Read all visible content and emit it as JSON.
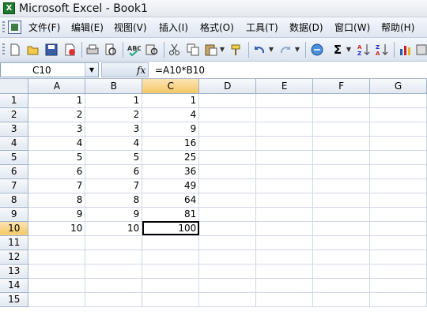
{
  "window": {
    "title": "Microsoft Excel - Book1",
    "app_icon_letter": "X"
  },
  "menu": {
    "items": [
      "文件(F)",
      "编辑(E)",
      "视图(V)",
      "插入(I)",
      "格式(O)",
      "工具(T)",
      "数据(D)",
      "窗口(W)",
      "帮助(H)"
    ]
  },
  "toolbar": {
    "icons": [
      "new-icon",
      "open-icon",
      "save-icon",
      "permission-icon",
      "print-icon",
      "print-preview-icon",
      "spelling-icon",
      "research-icon",
      "cut-icon",
      "copy-icon",
      "paste-icon",
      "format-painter-icon",
      "undo-icon",
      "redo-icon",
      "hyperlink-icon",
      "autosum-icon",
      "sort-ascending-icon",
      "sort-descending-icon",
      "chart-wizard-icon"
    ],
    "autosum_glyph": "Σ"
  },
  "formula_bar": {
    "name_box": "C10",
    "fx_label": "fx",
    "formula": "=A10*B10"
  },
  "grid": {
    "columns": [
      "A",
      "B",
      "C",
      "D",
      "E",
      "F",
      "G"
    ],
    "rows": [
      {
        "n": "1",
        "cells": [
          "1",
          "1",
          "1",
          "",
          "",
          "",
          ""
        ]
      },
      {
        "n": "2",
        "cells": [
          "2",
          "2",
          "4",
          "",
          "",
          "",
          ""
        ]
      },
      {
        "n": "3",
        "cells": [
          "3",
          "3",
          "9",
          "",
          "",
          "",
          ""
        ]
      },
      {
        "n": "4",
        "cells": [
          "4",
          "4",
          "16",
          "",
          "",
          "",
          ""
        ]
      },
      {
        "n": "5",
        "cells": [
          "5",
          "5",
          "25",
          "",
          "",
          "",
          ""
        ]
      },
      {
        "n": "6",
        "cells": [
          "6",
          "6",
          "36",
          "",
          "",
          "",
          ""
        ]
      },
      {
        "n": "7",
        "cells": [
          "7",
          "7",
          "49",
          "",
          "",
          "",
          ""
        ]
      },
      {
        "n": "8",
        "cells": [
          "8",
          "8",
          "64",
          "",
          "",
          "",
          ""
        ]
      },
      {
        "n": "9",
        "cells": [
          "9",
          "9",
          "81",
          "",
          "",
          "",
          ""
        ]
      },
      {
        "n": "10",
        "cells": [
          "10",
          "10",
          "100",
          "",
          "",
          "",
          ""
        ]
      },
      {
        "n": "11",
        "cells": [
          "",
          "",
          "",
          "",
          "",
          "",
          ""
        ]
      },
      {
        "n": "12",
        "cells": [
          "",
          "",
          "",
          "",
          "",
          "",
          ""
        ]
      },
      {
        "n": "13",
        "cells": [
          "",
          "",
          "",
          "",
          "",
          "",
          ""
        ]
      },
      {
        "n": "14",
        "cells": [
          "",
          "",
          "",
          "",
          "",
          "",
          ""
        ]
      },
      {
        "n": "15",
        "cells": [
          "",
          "",
          "",
          "",
          "",
          "",
          ""
        ]
      }
    ],
    "active_cell": "C10"
  }
}
